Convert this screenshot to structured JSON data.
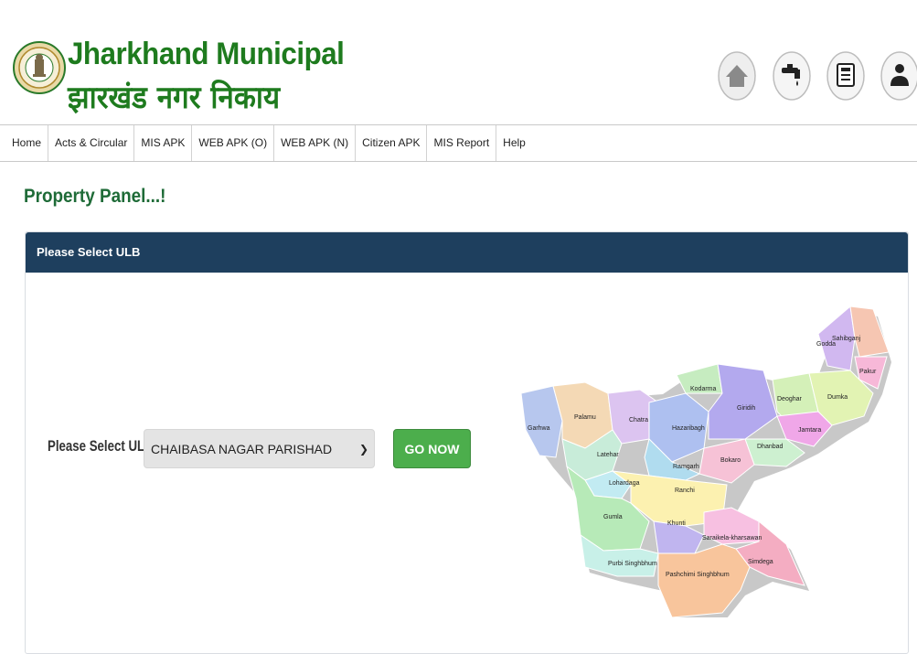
{
  "header": {
    "title_en": "Jharkhand Municipal",
    "title_hi": "झारखंड नगर निकाय",
    "logo_icon": "state-emblem-icon",
    "icons": [
      "home-icon",
      "water-tap-icon",
      "document-icon",
      "user-icon"
    ]
  },
  "nav": {
    "items": [
      "Home",
      "Acts & Circular",
      "MIS APK",
      "WEB APK (O)",
      "WEB APK (N)",
      "Citizen APK",
      "MIS Report",
      "Help"
    ]
  },
  "page": {
    "title": "Property Panel...!"
  },
  "panel": {
    "heading": "Please Select ULB",
    "select_label": "Please Select ULB",
    "selected_ulb": "CHAIBASA NAGAR PARISHAD",
    "go_button": "GO NOW"
  },
  "map": {
    "districts": [
      "Sahibganj",
      "Godda",
      "Pakur",
      "Dumka",
      "Deoghar",
      "Jamtara",
      "Giridih",
      "Kodarma",
      "Dhanbad",
      "Hazaribagh",
      "Chatra",
      "Palamu",
      "Garhwa",
      "Latehar",
      "Bokaro",
      "Ramgarh",
      "Lohardaga",
      "Ranchi",
      "Gumla",
      "Khunti",
      "Saraikela-kharsawan",
      "Simdega",
      "Purbi Singhbhum",
      "Pashchimi Singhbhum"
    ]
  },
  "colors": {
    "brand_green": "#1e7b1e",
    "panel_header": "#1e3f5e",
    "button_green": "#4cae4c"
  }
}
